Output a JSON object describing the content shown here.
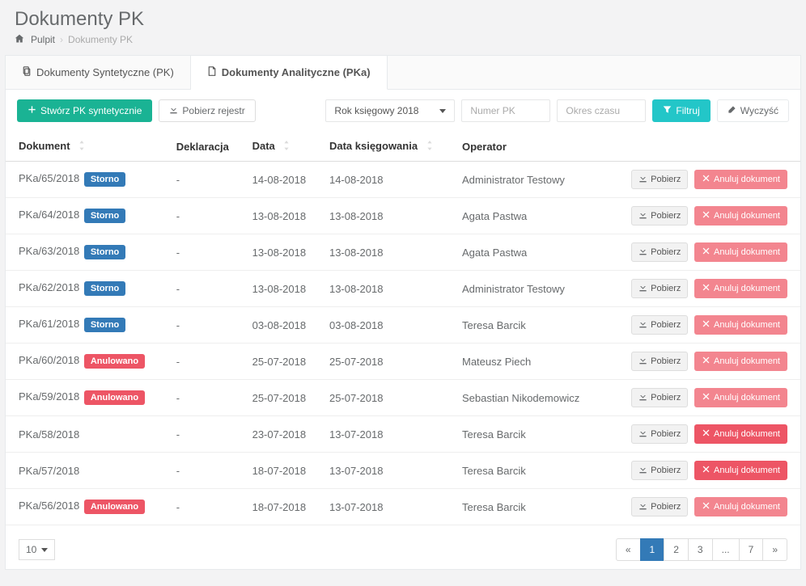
{
  "page": {
    "title": "Dokumenty PK",
    "breadcrumb": {
      "home": "Pulpit",
      "current": "Dokumenty PK"
    }
  },
  "tabs": {
    "synthetic": "Dokumenty Syntetyczne (PK)",
    "analytic": "Dokumenty Analityczne (PKa)"
  },
  "toolbar": {
    "create": "Stwórz PK syntetycznie",
    "download_register": "Pobierz rejestr",
    "year_select": "Rok księgowy 2018",
    "number_ph": "Numer PK",
    "period_ph": "Okres czasu",
    "filter": "Filtruj",
    "clear": "Wyczyść"
  },
  "columns": {
    "doc": "Dokument",
    "decl": "Deklaracja",
    "date": "Data",
    "book_date": "Data księgowania",
    "operator": "Operator"
  },
  "badges": {
    "storno": "Storno",
    "anulowano": "Anulowano"
  },
  "actions": {
    "download": "Pobierz",
    "cancel": "Anuluj dokument"
  },
  "rows": [
    {
      "doc": "PKa/65/2018",
      "badge": "storno",
      "decl": "-",
      "date": "14-08-2018",
      "book": "14-08-2018",
      "op": "Administrator Testowy",
      "faded": true
    },
    {
      "doc": "PKa/64/2018",
      "badge": "storno",
      "decl": "-",
      "date": "13-08-2018",
      "book": "13-08-2018",
      "op": "Agata Pastwa",
      "faded": true
    },
    {
      "doc": "PKa/63/2018",
      "badge": "storno",
      "decl": "-",
      "date": "13-08-2018",
      "book": "13-08-2018",
      "op": "Agata Pastwa",
      "faded": true
    },
    {
      "doc": "PKa/62/2018",
      "badge": "storno",
      "decl": "-",
      "date": "13-08-2018",
      "book": "13-08-2018",
      "op": "Administrator Testowy",
      "faded": true
    },
    {
      "doc": "PKa/61/2018",
      "badge": "storno",
      "decl": "-",
      "date": "03-08-2018",
      "book": "03-08-2018",
      "op": "Teresa Barcik",
      "faded": true
    },
    {
      "doc": "PKa/60/2018",
      "badge": "anulowano",
      "decl": "-",
      "date": "25-07-2018",
      "book": "25-07-2018",
      "op": "Mateusz Piech",
      "faded": true
    },
    {
      "doc": "PKa/59/2018",
      "badge": "anulowano",
      "decl": "-",
      "date": "25-07-2018",
      "book": "25-07-2018",
      "op": "Sebastian Nikodemowicz",
      "faded": true
    },
    {
      "doc": "PKa/58/2018",
      "badge": null,
      "decl": "-",
      "date": "23-07-2018",
      "book": "13-07-2018",
      "op": "Teresa Barcik",
      "faded": false
    },
    {
      "doc": "PKa/57/2018",
      "badge": null,
      "decl": "-",
      "date": "18-07-2018",
      "book": "13-07-2018",
      "op": "Teresa Barcik",
      "faded": false
    },
    {
      "doc": "PKa/56/2018",
      "badge": "anulowano",
      "decl": "-",
      "date": "18-07-2018",
      "book": "13-07-2018",
      "op": "Teresa Barcik",
      "faded": true
    }
  ],
  "pager": {
    "page_size": "10",
    "pages": [
      "«",
      "1",
      "2",
      "3",
      "...",
      "7",
      "»"
    ],
    "active": "1"
  }
}
